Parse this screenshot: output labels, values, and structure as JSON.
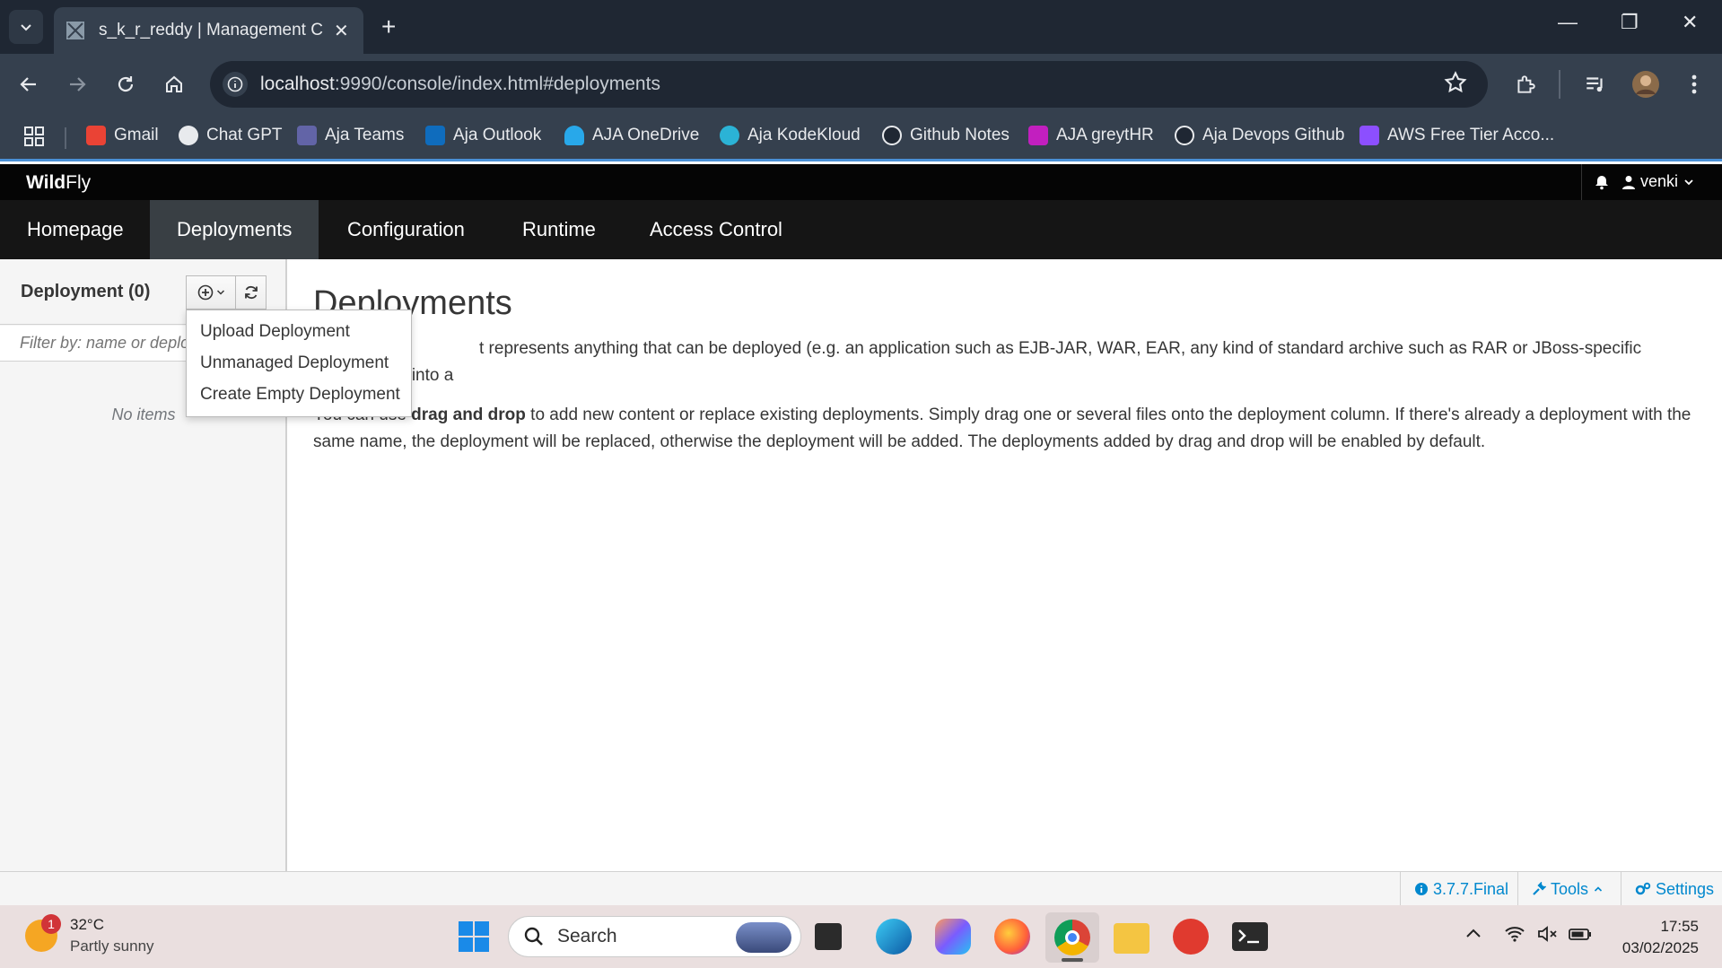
{
  "browser": {
    "tab_title": "s_k_r_reddy | Management Con",
    "url_host": "localhost",
    "url_rest": ":9990/console/index.html#deployments",
    "bookmarks": [
      {
        "label": "Gmail",
        "color": "#ea4335"
      },
      {
        "label": "Chat GPT",
        "color": "#e8eaed"
      },
      {
        "label": "Aja Teams",
        "color": "#6264a7"
      },
      {
        "label": "Aja Outlook",
        "color": "#0f6cbd"
      },
      {
        "label": "AJA OneDrive",
        "color": "#28a8ea"
      },
      {
        "label": "Aja KodeKloud",
        "color": "#2bb3d6"
      },
      {
        "label": "Github Notes",
        "color": "#1f2733"
      },
      {
        "label": "AJA greytHR",
        "color": "#c21fbf"
      },
      {
        "label": "Aja Devops Github",
        "color": "#1f2733"
      },
      {
        "label": "AWS Free Tier Acco...",
        "color": "#8c4fff"
      }
    ]
  },
  "app": {
    "brand_bold": "Wild",
    "brand_rest": "Fly",
    "user": "venki",
    "nav": [
      "Homepage",
      "Deployments",
      "Configuration",
      "Runtime",
      "Access Control"
    ],
    "active_nav": "Deployments"
  },
  "column": {
    "title": "Deployment (0)",
    "filter_placeholder": "Filter by: name or deployment",
    "empty_text": "No items"
  },
  "dropdown": {
    "items": [
      "Upload Deployment",
      "Unmanaged Deployment",
      "Create Empty Deployment"
    ]
  },
  "content": {
    "title": "Deployments",
    "para1_visible": "t represents anything that can be deployed (e.g. an application such as EJB-JAR, WAR, EAR, any kind of standard archive such as RAR or JBoss-specific deployment) into a",
    "para2_prefix": "You can use ",
    "para2_bold": "drag and drop",
    "para2_suffix": " to add new content or replace existing deployments. Simply drag one or several files onto the deployment column. If there's already a deployment with the same name, the deployment will be replaced, otherwise the deployment will be added. The deployments added by drag and drop will be enabled by default."
  },
  "footer": {
    "version": "3.7.7.Final",
    "tools": "Tools",
    "settings": "Settings"
  },
  "taskbar": {
    "weather_temp": "32°C",
    "weather_desc": "Partly sunny",
    "weather_badge": "1",
    "search_label": "Search",
    "time": "17:55",
    "date": "03/02/2025"
  },
  "colors": {
    "accent": "#0088ce",
    "nav_bg": "#151515",
    "chrome_dark": "#1f2733",
    "chrome_mid": "#35404e"
  }
}
